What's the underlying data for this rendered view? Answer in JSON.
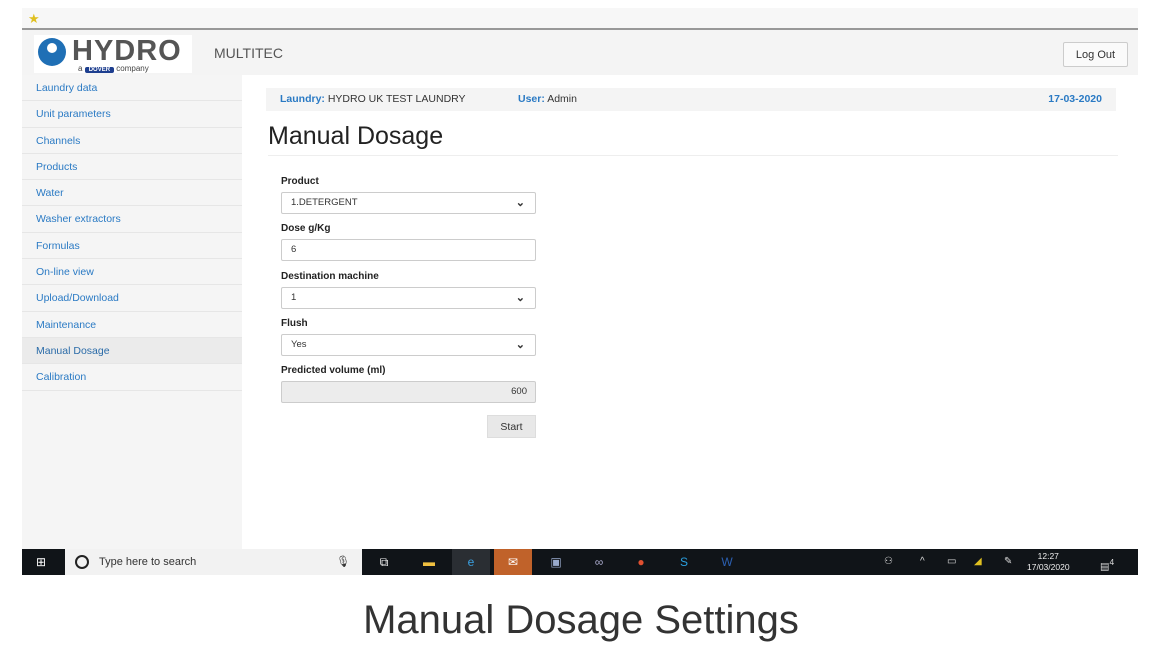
{
  "header": {
    "brand": "HYDRO",
    "brand_sub_prefix": "a",
    "brand_sub_mid": "DOVER",
    "brand_sub_suffix": "company",
    "app_title": "MULTITEC",
    "logout_label": "Log Out"
  },
  "sidebar": {
    "items": [
      {
        "label": "Laundry data"
      },
      {
        "label": "Unit parameters"
      },
      {
        "label": "Channels"
      },
      {
        "label": "Products"
      },
      {
        "label": "Water"
      },
      {
        "label": "Washer extractors"
      },
      {
        "label": "Formulas"
      },
      {
        "label": "On-line view"
      },
      {
        "label": "Upload/Download"
      },
      {
        "label": "Maintenance"
      },
      {
        "label": "Manual Dosage",
        "active": true
      },
      {
        "label": "Calibration"
      }
    ]
  },
  "infobar": {
    "laundry_label": "Laundry:",
    "laundry_value": "HYDRO UK TEST LAUNDRY",
    "user_label": "User:",
    "user_value": "Admin",
    "date": "17-03-2020"
  },
  "page": {
    "title": "Manual Dosage"
  },
  "form": {
    "product_label": "Product",
    "product_value": "1.DETERGENT",
    "dose_label": "Dose g/Kg",
    "dose_value": "6",
    "destination_label": "Destination machine",
    "destination_value": "1",
    "flush_label": "Flush",
    "flush_value": "Yes",
    "predicted_label": "Predicted volume (ml)",
    "predicted_value": "600",
    "start_label": "Start"
  },
  "taskbar": {
    "search_placeholder": "Type here to search",
    "time": "12:27",
    "date": "17/03/2020",
    "notifications": "4"
  },
  "caption": "Manual Dosage Settings"
}
